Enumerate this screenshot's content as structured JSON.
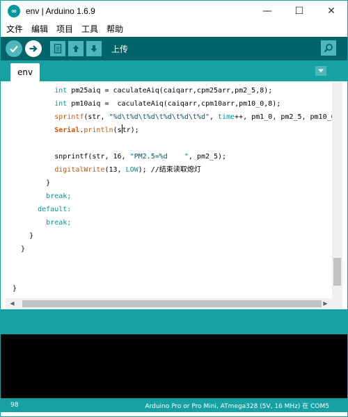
{
  "window": {
    "title": "env | Arduino 1.6.9",
    "logo_glyph": "∞",
    "controls": {
      "minimize": "—",
      "maximize": "☐",
      "close": "✕"
    }
  },
  "menubar": {
    "items": [
      "文件",
      "编辑",
      "项目",
      "工具",
      "帮助"
    ]
  },
  "toolbar": {
    "status_label": "上传",
    "buttons": {
      "verify": "✓",
      "upload": "→",
      "new": "▤",
      "open": "↑",
      "save": "↓",
      "serial_monitor": "⌕"
    }
  },
  "tabs": {
    "active": "env",
    "menu_glyph": "▼"
  },
  "code": {
    "line1": {
      "kw": "int",
      "rest": " pm25aiq = caculateAiq(caiqarr,cpm25arr,pm2_5,8);"
    },
    "line2": {
      "kw": "int",
      "rest": " pm10aiq =  caculateAiq(caiqarr,cpm10arr,pm10_0,8);"
    },
    "line3": {
      "fn": "sprintf",
      "a": "(str, ",
      "str": "\"%d\\t%d\\t%d\\t%d\\t%d\\t%d\"",
      "b": ", ",
      "kw": "time",
      "c": "++, pm1_0, pm2_5, pm10_0,"
    },
    "line4": {
      "cls": "Serial",
      "dot": ".",
      "fn": "println",
      "open": "(",
      "arg_a": "s",
      "arg_b": "tr",
      "close": ");"
    },
    "line6": {
      "a": "snprintf(str, 16, ",
      "str": "\"PM2.5=%d    \"",
      "b": ", pm2_5);"
    },
    "line7": {
      "fn": "digitalWrite",
      "a": "(13, ",
      "lit": "LOW",
      "b": "); ",
      "cm": "//结束读取熄灯"
    },
    "line8": "}",
    "line9": "break;",
    "line10": "default:",
    "line11": "break;",
    "line12": "}",
    "line13": "}",
    "line16": "}"
  },
  "statusbar": {
    "line_number": "98",
    "board": "Arduino Pro or Pro Mini, ATmega328 (5V, 16 MHz) 在 COM5"
  },
  "colors": {
    "toolbar_dark": "#006468",
    "accent_teal": "#17a1a5",
    "button_teal": "#4db7bb",
    "keyword": "#00979c",
    "function": "#d35400",
    "string": "#005c5f"
  }
}
